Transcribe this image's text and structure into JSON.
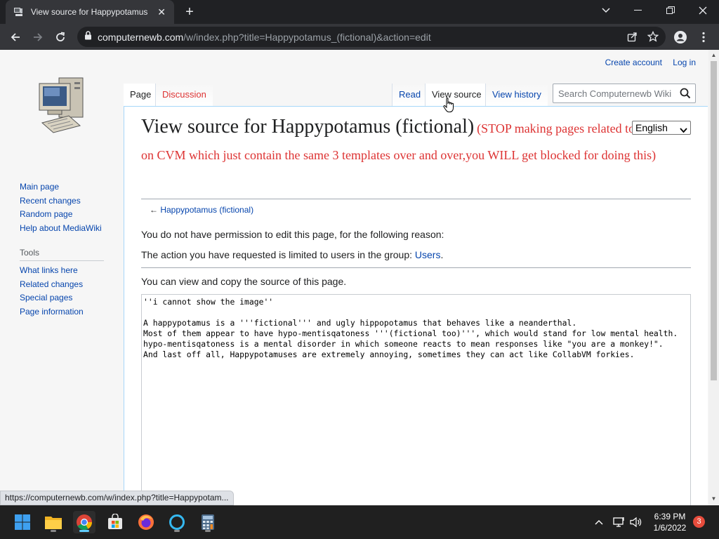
{
  "browser": {
    "tab_title": "View source for Happypotamus (fictional) - Computernewb Wiki",
    "url_host": "computernewb.com",
    "url_path": "/w/index.php?title=Happypotamus_(fictional)&action=edit",
    "status_url": "https://computernewb.com/w/index.php?title=Happypotam..."
  },
  "personal": {
    "create_account": "Create account",
    "log_in": "Log in"
  },
  "sidebar": {
    "nav": [
      "Main page",
      "Recent changes",
      "Random page",
      "Help about MediaWiki"
    ],
    "tools_heading": "Tools",
    "tools": [
      "What links here",
      "Related changes",
      "Special pages",
      "Page information"
    ]
  },
  "tabs": {
    "page": "Page",
    "discussion": "Discussion",
    "read": "Read",
    "view_source": "View source",
    "view_history": "View history"
  },
  "search": {
    "placeholder": "Search Computernewb Wiki"
  },
  "language": "English",
  "heading": {
    "main": "View source for Happypotamus (fictional)",
    "note": "(STOP making pages related to users on CVM which just contain the same 3 templates over and over,you WILL get blocked for doing this)"
  },
  "backlink": {
    "arrow": "←",
    "label": "Happypotamus (fictional)"
  },
  "messages": {
    "permission": "You do not have permission to edit this page, for the following reason:",
    "group_prefix": "The action you have requested is limited to users in the group: ",
    "group_link": "Users",
    "group_suffix": ".",
    "view_copy": "You can view and copy the source of this page."
  },
  "source_text": "''i cannot show the image''\n\nA happypotamus is a '''fictional''' and ugly hippopotamus that behaves like a neanderthal.\nMost of them appear to have hypo-mentisqatoness '''(fictional too)''', which would stand for low mental health.\nhypo-mentisqatoness is a mental disorder in which someone reacts to mean responses like \"you are a monkey!\".\nAnd last off all, Happypotamuses are extremely annoying, sometimes they can act like CollabVM forkies.",
  "taskbar": {
    "time": "6:39 PM",
    "date": "1/6/2022",
    "notifications": "3"
  },
  "colors": {
    "link": "#0645ad",
    "red_link": "#dd3333",
    "taskbar": "#202020"
  }
}
